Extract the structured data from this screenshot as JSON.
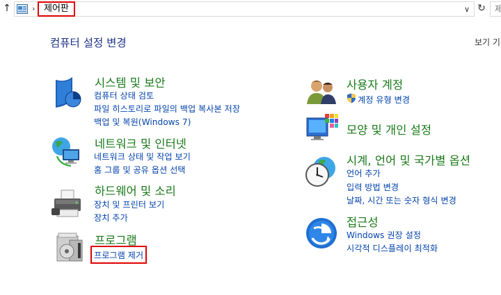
{
  "addressbar": {
    "breadcrumb": "제어판",
    "search_placeholder": "제어"
  },
  "header": {
    "title": "컴퓨터 설정 변경",
    "view_by": "보기 기"
  },
  "categories_left": [
    {
      "title": "시스템 및 보안",
      "links": [
        "컴퓨터 상태 검토",
        "파일 히스토리로 파일의 백업 복사본 저장",
        "백업 및 복원(Windows 7)"
      ]
    },
    {
      "title": "네트워크 및 인터넷",
      "links": [
        "네트워크 상태 및 작업 보기",
        "홈 그룹 및 공유 옵션 선택"
      ]
    },
    {
      "title": "하드웨어 및 소리",
      "links": [
        "장치 및 프린터 보기",
        "장치 추가"
      ]
    },
    {
      "title": "프로그램",
      "links": [
        "프로그램 제거"
      ]
    }
  ],
  "categories_right": [
    {
      "title": "사용자 계정",
      "links": [
        "계정 유형 변경"
      ]
    },
    {
      "title": "모양 및 개인 설정",
      "links": []
    },
    {
      "title": "시계, 언어 및 국가별 옵션",
      "links": [
        "언어 추가",
        "입력 방법 변경",
        "날짜, 시간 또는 숫자 형식 변경"
      ]
    },
    {
      "title": "접근성",
      "links": [
        "Windows 권장 설정",
        "시각적 디스플레이 최적화"
      ]
    }
  ],
  "colors": {
    "highlight": "#e00000",
    "category_title": "#1a7a1a",
    "link": "#0645ad",
    "heading": "#1e3287"
  }
}
